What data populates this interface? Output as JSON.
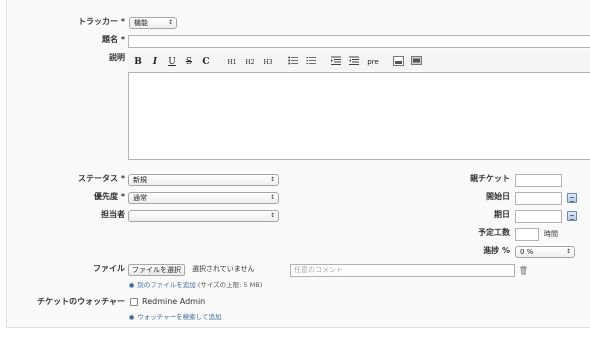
{
  "form": {
    "tracker": {
      "label": "トラッカー *",
      "value": "機能"
    },
    "subject": {
      "label": "題名 *",
      "value": ""
    },
    "description": {
      "label": "説明",
      "value": ""
    },
    "toolbar": {
      "bold": "B",
      "italic": "I",
      "underline": "U",
      "strike": "S",
      "code": "C",
      "h1": "H1",
      "h2": "H2",
      "h3": "H3",
      "pre": "pre"
    },
    "status": {
      "label": "ステータス *",
      "value": "新規"
    },
    "priority": {
      "label": "優先度 *",
      "value": "通常"
    },
    "assignee": {
      "label": "担当者",
      "value": ""
    },
    "parent": {
      "label": "親チケット",
      "value": ""
    },
    "start_date": {
      "label": "開始日",
      "value": ""
    },
    "due_date": {
      "label": "期日",
      "value": ""
    },
    "estimated": {
      "label": "予定工数",
      "value": "",
      "unit": "時間"
    },
    "done_ratio": {
      "label": "進捗 %",
      "value": "0 %"
    },
    "files": {
      "label": "ファイル",
      "choose_button": "ファイルを選択",
      "no_file": "選択されていません",
      "comment_placeholder": "任意のコメント",
      "add_link": "別のファイルを追加",
      "max_size": "(サイズの上限: 5 MB)"
    },
    "watchers": {
      "label": "チケットのウォッチャー",
      "user": "Redmine Admin",
      "search_link": "ウォッチャーを検索して追加"
    }
  }
}
